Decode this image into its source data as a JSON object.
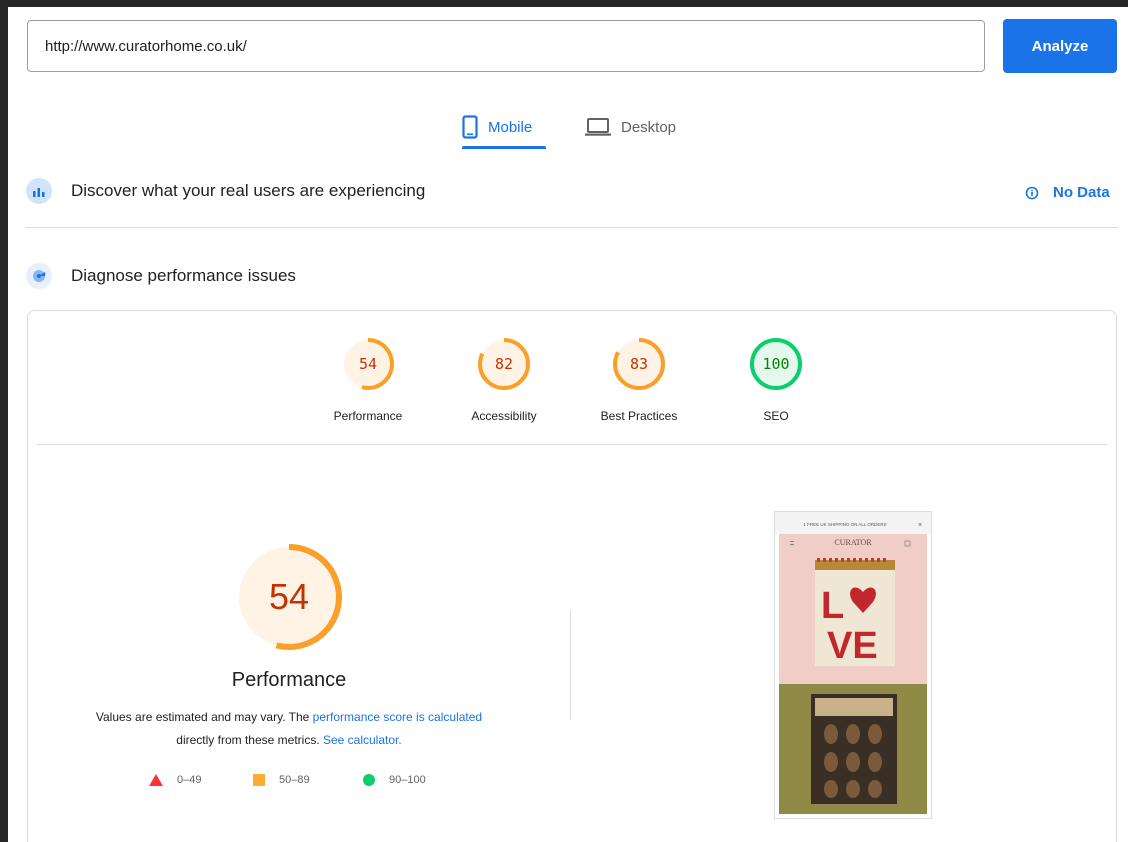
{
  "url_input": {
    "value": "http://www.curatorhome.co.uk/"
  },
  "analyze_label": "Analyze",
  "tabs": [
    {
      "label": "Mobile",
      "icon": "smartphone-icon",
      "selected": true
    },
    {
      "label": "Desktop",
      "icon": "laptop-icon",
      "selected": false
    }
  ],
  "crux": {
    "title": "Discover what your real users are experiencing",
    "status": "No Data",
    "icon": "field-data-icon"
  },
  "diagnose": {
    "title": "Diagnose performance issues",
    "icon": "lab-data-icon"
  },
  "scores": [
    {
      "label": "Performance",
      "value": "54",
      "fraction": 0.54,
      "color": "#fa9f28"
    },
    {
      "label": "Accessibility",
      "value": "82",
      "fraction": 0.82,
      "color": "#fa9f28"
    },
    {
      "label": "Best Practices",
      "value": "83",
      "fraction": 0.83,
      "color": "#fa9f28"
    },
    {
      "label": "SEO",
      "value": "100",
      "fraction": 1.0,
      "color": "#0cce6b"
    }
  ],
  "performance": {
    "score": "54",
    "fraction": 0.54,
    "title": "Performance",
    "desc_1": "Values are estimated and may vary. The ",
    "desc_link_1": "performance score is calculated",
    "desc_2": "directly from these metrics. ",
    "desc_link_2": "See calculator."
  },
  "legend": [
    {
      "shape": "triangle",
      "range": "0–49",
      "color": "#ff3333"
    },
    {
      "shape": "square",
      "range": "50–89",
      "color": "#ffaa33"
    },
    {
      "shape": "circle",
      "range": "90–100",
      "color": "#0cce6b"
    }
  ],
  "screenshot": {
    "banner": "1 FREE UK SHIPPING ON ALL ORDERS",
    "logo": "CURATOR",
    "product_text_1": "L",
    "product_text_2": "VE"
  },
  "colors": {
    "accent": "#1a73e8",
    "average": "#fa9f28",
    "pass": "#0cce6b",
    "fail": "#ff3333"
  }
}
